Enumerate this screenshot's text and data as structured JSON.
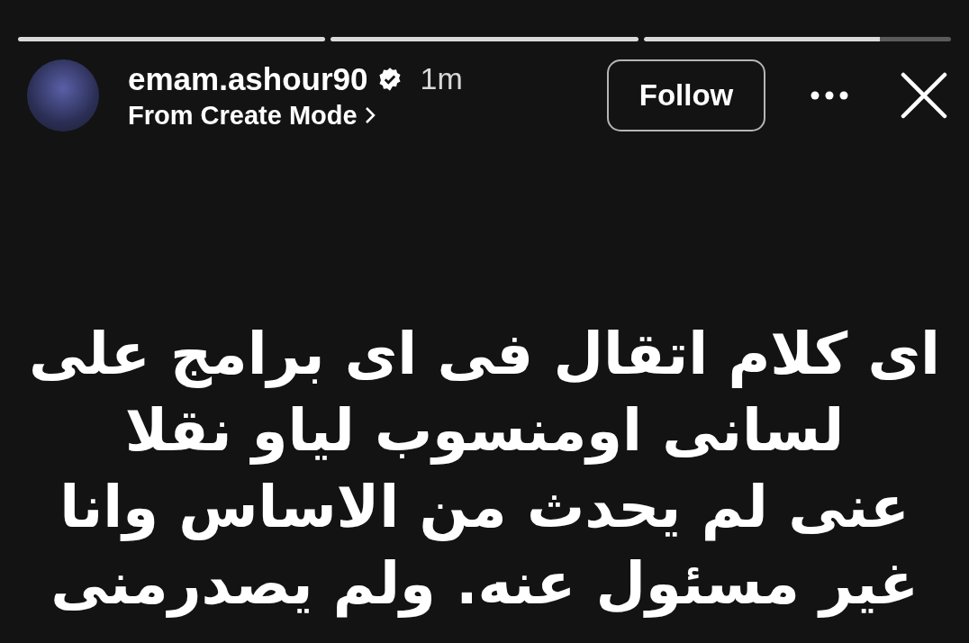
{
  "progress": [
    {
      "kind": "viewed"
    },
    {
      "kind": "viewed"
    },
    {
      "kind": "current",
      "level": 0.77
    }
  ],
  "header": {
    "username": "emam.ashour90",
    "verified": true,
    "time": "1m",
    "subtitle": "From Create Mode",
    "follow_button": "Follow"
  },
  "story_text": [
    "اى كلام اتقال فى اى برامج على",
    "لسانى اومنسوب لياو نقلا",
    "عنى لم يحدث من الاساس وانا",
    "غير مسئول عنه. ولم يصدرمنى"
  ]
}
